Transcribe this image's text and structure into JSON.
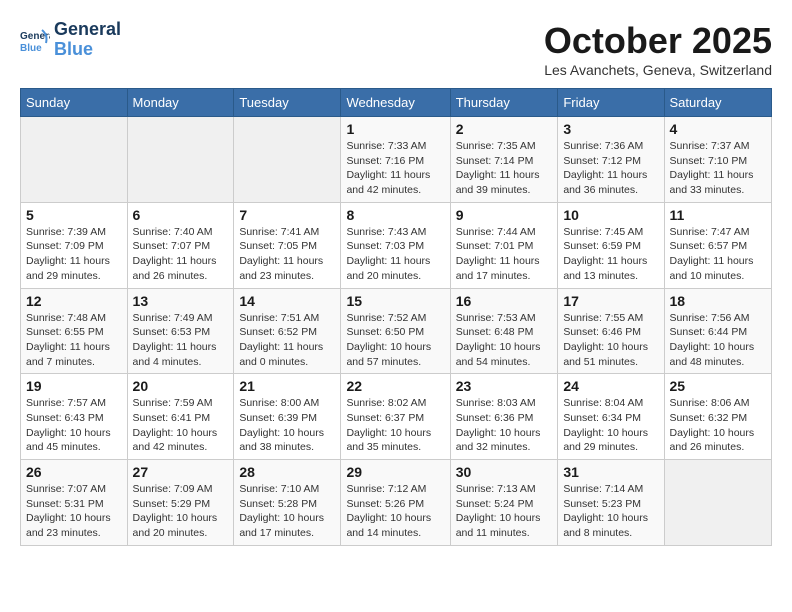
{
  "header": {
    "logo_line1": "General",
    "logo_line2": "Blue",
    "month": "October 2025",
    "location": "Les Avanchets, Geneva, Switzerland"
  },
  "weekdays": [
    "Sunday",
    "Monday",
    "Tuesday",
    "Wednesday",
    "Thursday",
    "Friday",
    "Saturday"
  ],
  "weeks": [
    [
      {
        "day": "",
        "info": ""
      },
      {
        "day": "",
        "info": ""
      },
      {
        "day": "",
        "info": ""
      },
      {
        "day": "1",
        "info": "Sunrise: 7:33 AM\nSunset: 7:16 PM\nDaylight: 11 hours and 42 minutes."
      },
      {
        "day": "2",
        "info": "Sunrise: 7:35 AM\nSunset: 7:14 PM\nDaylight: 11 hours and 39 minutes."
      },
      {
        "day": "3",
        "info": "Sunrise: 7:36 AM\nSunset: 7:12 PM\nDaylight: 11 hours and 36 minutes."
      },
      {
        "day": "4",
        "info": "Sunrise: 7:37 AM\nSunset: 7:10 PM\nDaylight: 11 hours and 33 minutes."
      }
    ],
    [
      {
        "day": "5",
        "info": "Sunrise: 7:39 AM\nSunset: 7:09 PM\nDaylight: 11 hours and 29 minutes."
      },
      {
        "day": "6",
        "info": "Sunrise: 7:40 AM\nSunset: 7:07 PM\nDaylight: 11 hours and 26 minutes."
      },
      {
        "day": "7",
        "info": "Sunrise: 7:41 AM\nSunset: 7:05 PM\nDaylight: 11 hours and 23 minutes."
      },
      {
        "day": "8",
        "info": "Sunrise: 7:43 AM\nSunset: 7:03 PM\nDaylight: 11 hours and 20 minutes."
      },
      {
        "day": "9",
        "info": "Sunrise: 7:44 AM\nSunset: 7:01 PM\nDaylight: 11 hours and 17 minutes."
      },
      {
        "day": "10",
        "info": "Sunrise: 7:45 AM\nSunset: 6:59 PM\nDaylight: 11 hours and 13 minutes."
      },
      {
        "day": "11",
        "info": "Sunrise: 7:47 AM\nSunset: 6:57 PM\nDaylight: 11 hours and 10 minutes."
      }
    ],
    [
      {
        "day": "12",
        "info": "Sunrise: 7:48 AM\nSunset: 6:55 PM\nDaylight: 11 hours and 7 minutes."
      },
      {
        "day": "13",
        "info": "Sunrise: 7:49 AM\nSunset: 6:53 PM\nDaylight: 11 hours and 4 minutes."
      },
      {
        "day": "14",
        "info": "Sunrise: 7:51 AM\nSunset: 6:52 PM\nDaylight: 11 hours and 0 minutes."
      },
      {
        "day": "15",
        "info": "Sunrise: 7:52 AM\nSunset: 6:50 PM\nDaylight: 10 hours and 57 minutes."
      },
      {
        "day": "16",
        "info": "Sunrise: 7:53 AM\nSunset: 6:48 PM\nDaylight: 10 hours and 54 minutes."
      },
      {
        "day": "17",
        "info": "Sunrise: 7:55 AM\nSunset: 6:46 PM\nDaylight: 10 hours and 51 minutes."
      },
      {
        "day": "18",
        "info": "Sunrise: 7:56 AM\nSunset: 6:44 PM\nDaylight: 10 hours and 48 minutes."
      }
    ],
    [
      {
        "day": "19",
        "info": "Sunrise: 7:57 AM\nSunset: 6:43 PM\nDaylight: 10 hours and 45 minutes."
      },
      {
        "day": "20",
        "info": "Sunrise: 7:59 AM\nSunset: 6:41 PM\nDaylight: 10 hours and 42 minutes."
      },
      {
        "day": "21",
        "info": "Sunrise: 8:00 AM\nSunset: 6:39 PM\nDaylight: 10 hours and 38 minutes."
      },
      {
        "day": "22",
        "info": "Sunrise: 8:02 AM\nSunset: 6:37 PM\nDaylight: 10 hours and 35 minutes."
      },
      {
        "day": "23",
        "info": "Sunrise: 8:03 AM\nSunset: 6:36 PM\nDaylight: 10 hours and 32 minutes."
      },
      {
        "day": "24",
        "info": "Sunrise: 8:04 AM\nSunset: 6:34 PM\nDaylight: 10 hours and 29 minutes."
      },
      {
        "day": "25",
        "info": "Sunrise: 8:06 AM\nSunset: 6:32 PM\nDaylight: 10 hours and 26 minutes."
      }
    ],
    [
      {
        "day": "26",
        "info": "Sunrise: 7:07 AM\nSunset: 5:31 PM\nDaylight: 10 hours and 23 minutes."
      },
      {
        "day": "27",
        "info": "Sunrise: 7:09 AM\nSunset: 5:29 PM\nDaylight: 10 hours and 20 minutes."
      },
      {
        "day": "28",
        "info": "Sunrise: 7:10 AM\nSunset: 5:28 PM\nDaylight: 10 hours and 17 minutes."
      },
      {
        "day": "29",
        "info": "Sunrise: 7:12 AM\nSunset: 5:26 PM\nDaylight: 10 hours and 14 minutes."
      },
      {
        "day": "30",
        "info": "Sunrise: 7:13 AM\nSunset: 5:24 PM\nDaylight: 10 hours and 11 minutes."
      },
      {
        "day": "31",
        "info": "Sunrise: 7:14 AM\nSunset: 5:23 PM\nDaylight: 10 hours and 8 minutes."
      },
      {
        "day": "",
        "info": ""
      }
    ]
  ]
}
